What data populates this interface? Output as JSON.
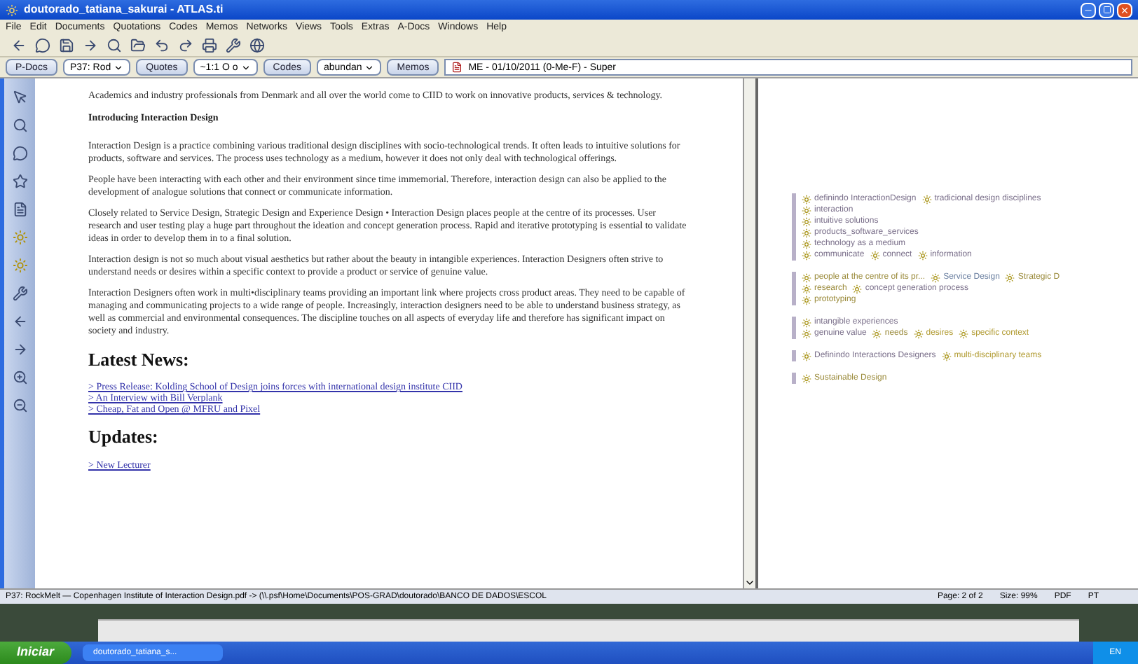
{
  "window": {
    "title": "doutorado_tatiana_sakurai - ATLAS.ti"
  },
  "menu": [
    "File",
    "Edit",
    "Documents",
    "Quotations",
    "Codes",
    "Memos",
    "Networks",
    "Views",
    "Tools",
    "Extras",
    "A-Docs",
    "Windows",
    "Help"
  ],
  "navbar": [
    {
      "kind": "button",
      "label": "P-Docs"
    },
    {
      "kind": "combo",
      "label": "P37: Rod"
    },
    {
      "kind": "button",
      "label": "Quotes"
    },
    {
      "kind": "combo",
      "label": "~1:1 O o"
    },
    {
      "kind": "button",
      "label": "Codes"
    },
    {
      "kind": "combo",
      "label": "abundan"
    },
    {
      "kind": "button",
      "label": "Memos"
    },
    {
      "kind": "memo",
      "label": "ME - 01/10/2011 (0-Me-F) - Super"
    }
  ],
  "document": [
    {
      "kind": "paragraph",
      "text": "Academics and industry professionals from Denmark and all over the world come to CIID to work on innovative products, services & technology."
    },
    {
      "kind": "subheading",
      "text": "Introducing Interaction Design"
    },
    {
      "kind": "paragraph",
      "text": "Interaction Design is a practice combining various traditional design disciplines with socio-technological trends. It often leads to intuitive solutions for products, software and services. The process uses technology as a medium, however it does not only deal with technological offerings."
    },
    {
      "kind": "paragraph",
      "text": "People have been interacting with each other and their environment since time immemorial. Therefore, interaction design can also be applied to the development of analogue solutions that connect or communicate information."
    },
    {
      "kind": "paragraph",
      "text": "Closely related to Service Design, Strategic Design and Experience Design • Interaction Design places people at the centre of its processes. User research and user testing play a huge part throughout the ideation and concept generation process. Rapid and iterative prototyping is essential to validate ideas in order to develop them in to a final solution."
    },
    {
      "kind": "paragraph",
      "text": "Interaction design is not so much about visual aesthetics but rather about the beauty in intangible experiences. Interaction Designers often strive to understand needs or desires within a specific context to provide a product or service of genuine value."
    },
    {
      "kind": "paragraph",
      "text": "Interaction Designers often work in multi•disciplinary teams providing an important link where projects cross product areas. They need to be capable of managing and communicating projects to a wide range of people. Increasingly, interaction designers need to be able to understand business strategy, as well as commercial and environmental consequences. The discipline touches on all aspects of everyday life and therefore has significant impact on society and industry."
    },
    {
      "kind": "heading",
      "text": "Latest News:"
    },
    {
      "kind": "links",
      "items": [
        "> Press Release: Kolding School of Design joins forces with international design institute CIID",
        "> An Interview with Bill Verplank",
        "> Cheap, Fat and Open @ MFRU and Pixel"
      ]
    },
    {
      "kind": "heading",
      "text": "Updates:"
    },
    {
      "kind": "links",
      "items": [
        "> New Lecturer"
      ]
    }
  ],
  "margin": [
    [
      [
        {
          "label": "definindo InteractionDesign",
          "color": "#7a6f8a"
        },
        {
          "label": "tradicional design disciplines",
          "color": "#7a6f8a"
        }
      ],
      [
        {
          "label": "interaction",
          "color": "#7a6f8a"
        }
      ],
      [
        {
          "label": "intuitive solutions",
          "color": "#7a6f8a"
        }
      ],
      [
        {
          "label": "products_software_services",
          "color": "#7a6f8a"
        }
      ],
      [
        {
          "label": "technology as a medium",
          "color": "#7a6f8a"
        }
      ],
      [
        {
          "label": "communicate",
          "color": "#7a6f8a"
        },
        {
          "label": "connect",
          "color": "#7a6f8a"
        },
        {
          "label": "information",
          "color": "#7a6f8a"
        }
      ]
    ],
    [
      [
        {
          "label": "people at the centre of its pr...",
          "color": "#9a8a3a"
        },
        {
          "label": "Service Design",
          "color": "#6a7fa0"
        },
        {
          "label": "Strategic D",
          "color": "#9a8a3a"
        }
      ],
      [
        {
          "label": "research",
          "color": "#9a8a3a"
        },
        {
          "label": "concept generation process",
          "color": "#7a6f8a"
        }
      ],
      [
        {
          "label": "prototyping",
          "color": "#9a8a3a"
        }
      ]
    ],
    [
      [
        {
          "label": "intangible experiences",
          "color": "#7a6f8a"
        }
      ],
      [
        {
          "label": "genuine value",
          "color": "#7a6f8a"
        },
        {
          "label": "needs",
          "color": "#9a8a3a"
        },
        {
          "label": "desires",
          "color": "#b09a30"
        },
        {
          "label": "specific context",
          "color": "#b09a30"
        }
      ]
    ],
    [
      [
        {
          "label": "Definindo Interactions Designers",
          "color": "#7a6f8a"
        },
        {
          "label": "multi-disciplinary teams",
          "color": "#b09a30"
        }
      ]
    ],
    [
      [
        {
          "label": "Sustainable Design",
          "color": "#9a8a3a"
        }
      ]
    ]
  ],
  "status_bar": {
    "path": "P37: RockMelt — Copenhagen Institute of Interaction Design.pdf -> (\\\\.psf\\Home\\Documents\\POS-GRAD\\doutorado\\BANCO DE DADOS\\ESCOL",
    "page": "Page: 2 of 2",
    "size": "Size: 99%",
    "format": "PDF",
    "lang": "PT"
  },
  "taskbar": {
    "start": "Iniciar",
    "tasks": [
      "doutorado_tatiana_s..."
    ],
    "tray": "EN"
  }
}
